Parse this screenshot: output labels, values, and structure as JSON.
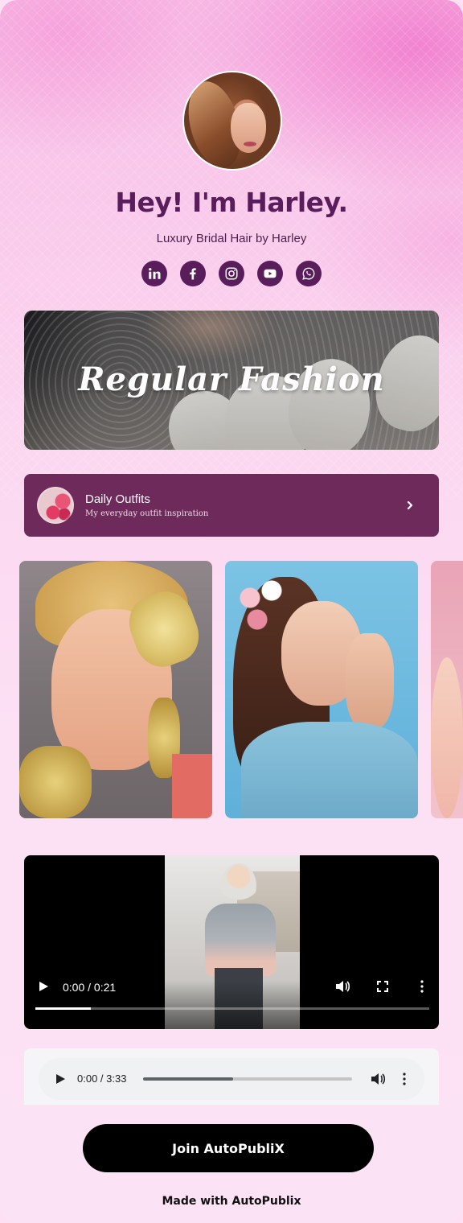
{
  "profile": {
    "title": "Hey! I'm Harley.",
    "subtitle": "Luxury Bridal Hair by Harley"
  },
  "socials": [
    {
      "name": "linkedin-icon"
    },
    {
      "name": "facebook-icon"
    },
    {
      "name": "instagram-icon"
    },
    {
      "name": "youtube-icon"
    },
    {
      "name": "whatsapp-icon"
    }
  ],
  "banner": {
    "text": "Regular Fashion"
  },
  "link_card": {
    "title": "Daily Outfits",
    "description": "My everyday outfit inspiration",
    "icon": "chevron-right-icon"
  },
  "video": {
    "time": "0:00 / 0:21",
    "progress": 0.14
  },
  "audio": {
    "time": "0:00 / 3:33",
    "progress": 0.43
  },
  "cta": {
    "label": "Join AutoPubliX"
  },
  "footer": {
    "text": "Made with AutoPublix"
  },
  "colors": {
    "accent": "#5a1d5c",
    "card": "#6e2a5a",
    "background": "#fce0f3"
  }
}
